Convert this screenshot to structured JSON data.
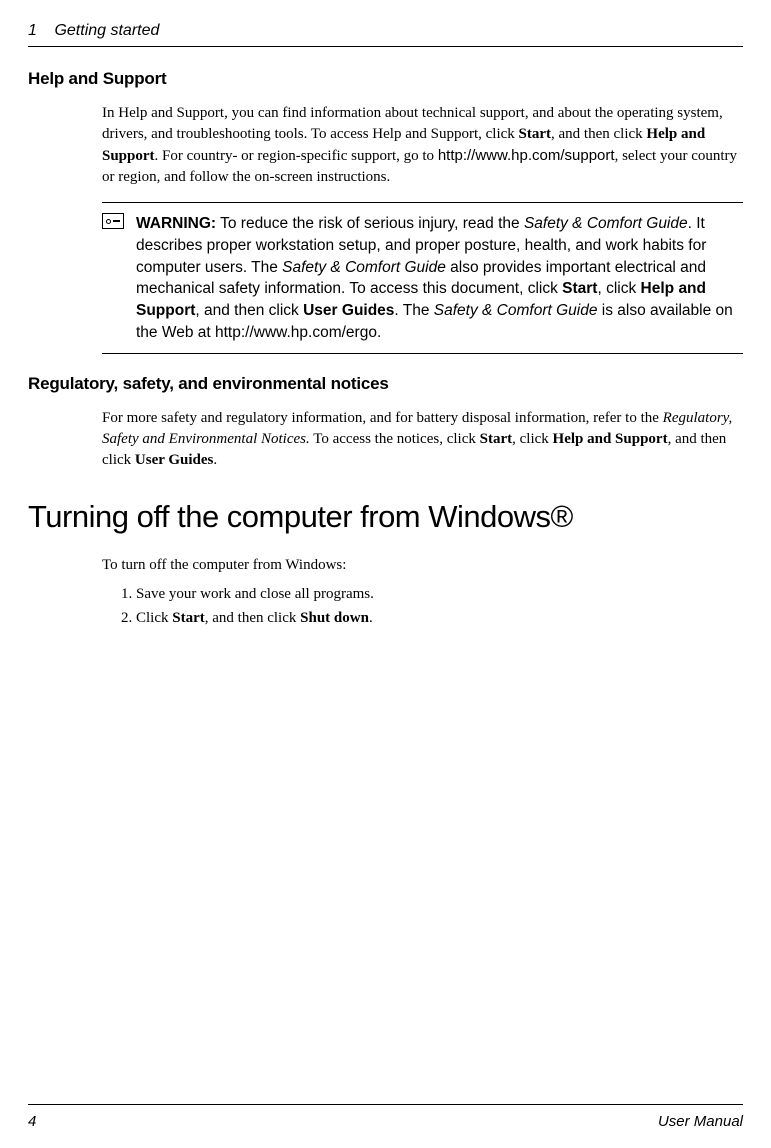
{
  "header": {
    "chapter_num": "1",
    "chapter_title": "Getting started"
  },
  "sections": {
    "help_support": {
      "title": "Help and Support",
      "p1_a": "In Help and Support, you can find information about technical support, and about the operating system, drivers, and troubleshooting tools. To access Help and Support, click ",
      "p1_b": "Start",
      "p1_c": ", and then click ",
      "p1_d": "Help and Support",
      "p1_e": ". For country- or region-specific support, go to ",
      "p1_url": "http://www.hp.com/support",
      "p1_f": ", select your country or region, and follow the on-screen instructions."
    },
    "warning": {
      "label": "WARNING:",
      "t1": " To reduce the risk of serious injury, read the ",
      "t2": "Safety & Comfort Guide",
      "t3": ". It describes proper workstation setup, and proper posture, health, and work habits for computer users. The ",
      "t4": "Safety & Comfort Guide",
      "t5": " also provides important electrical and mechanical safety information. To access this document, click ",
      "t6": "Start",
      "t7": ", click ",
      "t8": "Help and Support",
      "t9": ", and then click ",
      "t10": "User Guides",
      "t11": ". The ",
      "t12": "Safety & Comfort Guide",
      "t13": " is also available on the Web at ",
      "url": "http://www.hp.com/ergo",
      "t14": "."
    },
    "regulatory": {
      "title": "Regulatory, safety, and environmental notices",
      "p1_a": "For more safety and regulatory information, and for battery disposal information, refer to the ",
      "p1_b": "Regulatory, Safety and Environmental Notices.",
      "p1_c": " To access the notices, click ",
      "p1_d": "Start",
      "p1_e": ", click ",
      "p1_f": "Help and Support",
      "p1_g": ", and then click ",
      "p1_h": "User Guides",
      "p1_i": "."
    },
    "turnoff": {
      "title": "Turning off the computer from Windows®",
      "intro": "To turn off the computer from Windows:",
      "step1": "Save your work and close all programs.",
      "step2_a": "Click ",
      "step2_b": "Start",
      "step2_c": ", and then click ",
      "step2_d": "Shut down",
      "step2_e": "."
    }
  },
  "footer": {
    "page": "4",
    "doc": "User Manual"
  }
}
